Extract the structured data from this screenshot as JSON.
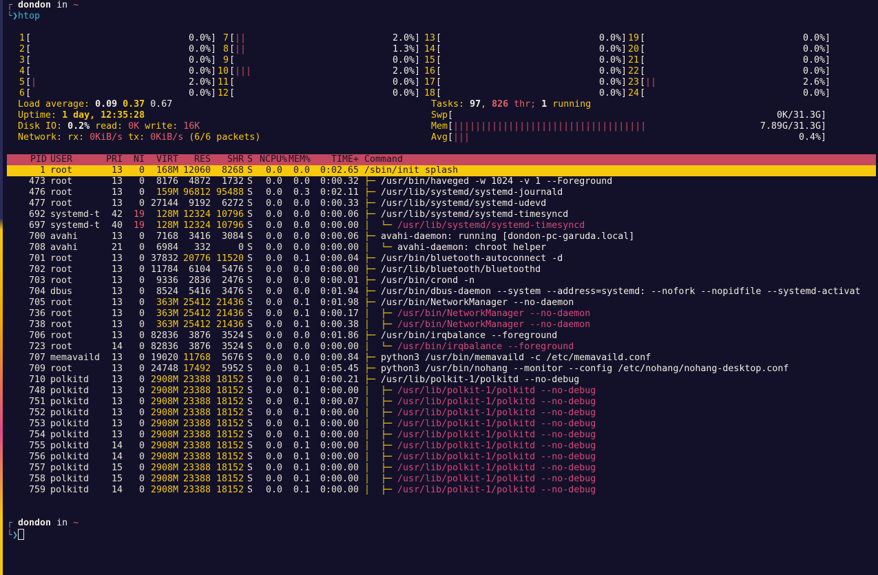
{
  "prompt1": {
    "user": "dondon",
    "in": "in",
    "dir": "~",
    "command": "htop"
  },
  "cpus": [
    {
      "id": "1",
      "bar": "",
      "pct": "0.0%"
    },
    {
      "id": "2",
      "bar": "",
      "pct": "0.0%"
    },
    {
      "id": "3",
      "bar": "",
      "pct": "0.0%"
    },
    {
      "id": "4",
      "bar": "",
      "pct": "0.0%"
    },
    {
      "id": "5",
      "bar": "|",
      "pct": "2.0%"
    },
    {
      "id": "6",
      "bar": "",
      "pct": "0.0%"
    },
    {
      "id": "7",
      "bar": "||",
      "pct": "2.0%"
    },
    {
      "id": "8",
      "bar": "||",
      "pct": "1.3%"
    },
    {
      "id": "9",
      "bar": "",
      "pct": "0.0%"
    },
    {
      "id": "10",
      "bar": "|||",
      "pct": "2.0%"
    },
    {
      "id": "11",
      "bar": "",
      "pct": "0.0%"
    },
    {
      "id": "12",
      "bar": "",
      "pct": "0.0%"
    },
    {
      "id": "13",
      "bar": "",
      "pct": "0.0%"
    },
    {
      "id": "14",
      "bar": "",
      "pct": "0.0%"
    },
    {
      "id": "15",
      "bar": "",
      "pct": "0.0%"
    },
    {
      "id": "16",
      "bar": "",
      "pct": "0.0%"
    },
    {
      "id": "17",
      "bar": "",
      "pct": "0.0%"
    },
    {
      "id": "18",
      "bar": "",
      "pct": "0.0%"
    },
    {
      "id": "19",
      "bar": "",
      "pct": "0.0%"
    },
    {
      "id": "20",
      "bar": "",
      "pct": "0.0%"
    },
    {
      "id": "21",
      "bar": "",
      "pct": "0.0%"
    },
    {
      "id": "22",
      "bar": "",
      "pct": "0.0%"
    },
    {
      "id": "23",
      "bar": "||",
      "pct": "2.6%"
    },
    {
      "id": "24",
      "bar": "",
      "pct": "0.0%"
    }
  ],
  "load": {
    "label": "Load average:",
    "v1": "0.09",
    "v2": "0.37",
    "v3": "0.67"
  },
  "uptime": {
    "label": "Uptime:",
    "value": "1 day, 12:35:28"
  },
  "disk": {
    "label": "Disk IO:",
    "pct": "0.2%",
    "read_label": "read:",
    "read": "0K",
    "write_label": "write:",
    "write": "16K"
  },
  "network": {
    "label": "Network:",
    "rx_label": "rx:",
    "rx": "0KiB/s",
    "tx_label": "tx:",
    "tx": "0KiB/s",
    "packets": "(6/6 packets)"
  },
  "tasks": {
    "label": "Tasks:",
    "count": "97",
    "comma": ",",
    "thr": "826",
    "thr_label": "thr;",
    "running": "1",
    "running_label": "running"
  },
  "swp": {
    "label": "Swp",
    "bar": "",
    "value": "0K/31.3G"
  },
  "mem": {
    "label": "Mem",
    "bar": "|||||||||||||||||||||||||||||||||||",
    "value": "7.89G/31.3G"
  },
  "avg": {
    "label": "Avg",
    "bar": "|||",
    "value": "0.4%"
  },
  "header": {
    "pid": "PID",
    "user": "USER",
    "pri": "PRI",
    "ni": "NI",
    "virt": "VIRT",
    "res": "RES",
    "shr": "SHR",
    "s": "S",
    "cpu": "NCPU%",
    "mem": "MEM%",
    "time": "TIME+",
    "cmd": "Command"
  },
  "processes": [
    {
      "pid": "1",
      "user": "root",
      "pri": "13",
      "ni": "0",
      "virt": "168M",
      "res": "12060",
      "shr": "8268",
      "s": "S",
      "cpu": "0.0",
      "mem": "0.0",
      "time": "0:02.65",
      "tree": "",
      "cmd": "/sbin/init splash",
      "thread": false,
      "selected": true
    },
    {
      "pid": "473",
      "user": "root",
      "pri": "13",
      "ni": "0",
      "virt": "8176",
      "res": "4872",
      "shr": "1732",
      "s": "S",
      "cpu": "0.0",
      "mem": "0.0",
      "time": "0:00.32",
      "tree": "├─ ",
      "cmd": "/usr/bin/haveged -w 1024 -v 1 --Foreground",
      "thread": false
    },
    {
      "pid": "476",
      "user": "root",
      "pri": "13",
      "ni": "0",
      "virt": "159M",
      "res": "96812",
      "shr": "95488",
      "s": "S",
      "cpu": "0.0",
      "mem": "0.3",
      "time": "0:02.11",
      "tree": "├─ ",
      "cmd": "/usr/lib/systemd/systemd-journald",
      "thread": false
    },
    {
      "pid": "477",
      "user": "root",
      "pri": "13",
      "ni": "0",
      "virt": "27144",
      "res": "9192",
      "shr": "6272",
      "s": "S",
      "cpu": "0.0",
      "mem": "0.0",
      "time": "0:00.33",
      "tree": "├─ ",
      "cmd": "/usr/lib/systemd/systemd-udevd",
      "thread": false
    },
    {
      "pid": "692",
      "user": "systemd-t",
      "pri": "42",
      "ni": "19",
      "virt": "128M",
      "res": "12324",
      "shr": "10796",
      "s": "S",
      "cpu": "0.0",
      "mem": "0.0",
      "time": "0:00.06",
      "tree": "├─ ",
      "cmd": "/usr/lib/systemd/systemd-timesyncd",
      "thread": false
    },
    {
      "pid": "697",
      "user": "systemd-t",
      "pri": "40",
      "ni": "19",
      "virt": "128M",
      "res": "12324",
      "shr": "10796",
      "s": "S",
      "cpu": "0.0",
      "mem": "0.0",
      "time": "0:00.00",
      "tree": "│  └─ ",
      "cmd": "/usr/lib/systemd/systemd-timesyncd",
      "thread": true
    },
    {
      "pid": "700",
      "user": "avahi",
      "pri": "13",
      "ni": "0",
      "virt": "7168",
      "res": "3416",
      "shr": "3084",
      "s": "S",
      "cpu": "0.0",
      "mem": "0.0",
      "time": "0:00.06",
      "tree": "├─ ",
      "cmd": "avahi-daemon: running [dondon-pc-garuda.local]",
      "thread": false
    },
    {
      "pid": "708",
      "user": "avahi",
      "pri": "21",
      "ni": "0",
      "virt": "6984",
      "res": "332",
      "shr": "0",
      "s": "S",
      "cpu": "0.0",
      "mem": "0.0",
      "time": "0:00.00",
      "tree": "│  └─ ",
      "cmd": "avahi-daemon: chroot helper",
      "thread": false
    },
    {
      "pid": "701",
      "user": "root",
      "pri": "13",
      "ni": "0",
      "virt": "37832",
      "res": "20776",
      "shr": "11520",
      "s": "S",
      "cpu": "0.0",
      "mem": "0.1",
      "time": "0:00.04",
      "tree": "├─ ",
      "cmd": "/usr/bin/bluetooth-autoconnect -d",
      "thread": false
    },
    {
      "pid": "702",
      "user": "root",
      "pri": "13",
      "ni": "0",
      "virt": "11784",
      "res": "6104",
      "shr": "5476",
      "s": "S",
      "cpu": "0.0",
      "mem": "0.0",
      "time": "0:00.00",
      "tree": "├─ ",
      "cmd": "/usr/lib/bluetooth/bluetoothd",
      "thread": false
    },
    {
      "pid": "703",
      "user": "root",
      "pri": "13",
      "ni": "0",
      "virt": "9336",
      "res": "2836",
      "shr": "2476",
      "s": "S",
      "cpu": "0.0",
      "mem": "0.0",
      "time": "0:00.01",
      "tree": "├─ ",
      "cmd": "/usr/bin/crond -n",
      "thread": false
    },
    {
      "pid": "704",
      "user": "dbus",
      "pri": "13",
      "ni": "0",
      "virt": "8524",
      "res": "5416",
      "shr": "3476",
      "s": "S",
      "cpu": "0.0",
      "mem": "0.0",
      "time": "0:01.94",
      "tree": "├─ ",
      "cmd": "/usr/bin/dbus-daemon --system --address=systemd: --nofork --nopidfile --systemd-activat",
      "thread": false
    },
    {
      "pid": "705",
      "user": "root",
      "pri": "13",
      "ni": "0",
      "virt": "363M",
      "res": "25412",
      "shr": "21436",
      "s": "S",
      "cpu": "0.0",
      "mem": "0.1",
      "time": "0:01.98",
      "tree": "├─ ",
      "cmd": "/usr/bin/NetworkManager --no-daemon",
      "thread": false
    },
    {
      "pid": "736",
      "user": "root",
      "pri": "13",
      "ni": "0",
      "virt": "363M",
      "res": "25412",
      "shr": "21436",
      "s": "S",
      "cpu": "0.0",
      "mem": "0.1",
      "time": "0:00.17",
      "tree": "│  ├─ ",
      "cmd": "/usr/bin/NetworkManager --no-daemon",
      "thread": true
    },
    {
      "pid": "738",
      "user": "root",
      "pri": "13",
      "ni": "0",
      "virt": "363M",
      "res": "25412",
      "shr": "21436",
      "s": "S",
      "cpu": "0.0",
      "mem": "0.1",
      "time": "0:00.38",
      "tree": "│  ├─ ",
      "cmd": "/usr/bin/NetworkManager --no-daemon",
      "thread": true
    },
    {
      "pid": "706",
      "user": "root",
      "pri": "13",
      "ni": "0",
      "virt": "82836",
      "res": "3876",
      "shr": "3524",
      "s": "S",
      "cpu": "0.0",
      "mem": "0.0",
      "time": "0:01.86",
      "tree": "├─ ",
      "cmd": "/usr/bin/irqbalance --foreground",
      "thread": false
    },
    {
      "pid": "723",
      "user": "root",
      "pri": "14",
      "ni": "0",
      "virt": "82836",
      "res": "3876",
      "shr": "3524",
      "s": "S",
      "cpu": "0.0",
      "mem": "0.0",
      "time": "0:00.00",
      "tree": "│  └─ ",
      "cmd": "/usr/bin/irqbalance --foreground",
      "thread": true
    },
    {
      "pid": "707",
      "user": "memavaild",
      "pri": "13",
      "ni": "0",
      "virt": "19020",
      "res": "11768",
      "shr": "5676",
      "s": "S",
      "cpu": "0.0",
      "mem": "0.0",
      "time": "0:00.84",
      "tree": "├─ ",
      "cmd": "python3 /usr/bin/memavaild -c /etc/memavaild.conf",
      "thread": false
    },
    {
      "pid": "709",
      "user": "root",
      "pri": "13",
      "ni": "0",
      "virt": "24748",
      "res": "17492",
      "shr": "5952",
      "s": "S",
      "cpu": "0.0",
      "mem": "0.1",
      "time": "0:05.45",
      "tree": "├─ ",
      "cmd": "python3 /usr/bin/nohang --monitor --config /etc/nohang/nohang-desktop.conf",
      "thread": false
    },
    {
      "pid": "710",
      "user": "polkitd",
      "pri": "13",
      "ni": "0",
      "virt": "2908M",
      "res": "23388",
      "shr": "18152",
      "s": "S",
      "cpu": "0.0",
      "mem": "0.1",
      "time": "0:00.21",
      "tree": "├─ ",
      "cmd": "/usr/lib/polkit-1/polkitd --no-debug",
      "thread": false
    },
    {
      "pid": "748",
      "user": "polkitd",
      "pri": "13",
      "ni": "0",
      "virt": "2908M",
      "res": "23388",
      "shr": "18152",
      "s": "S",
      "cpu": "0.0",
      "mem": "0.1",
      "time": "0:00.00",
      "tree": "│  ├─ ",
      "cmd": "/usr/lib/polkit-1/polkitd --no-debug",
      "thread": true
    },
    {
      "pid": "751",
      "user": "polkitd",
      "pri": "13",
      "ni": "0",
      "virt": "2908M",
      "res": "23388",
      "shr": "18152",
      "s": "S",
      "cpu": "0.0",
      "mem": "0.1",
      "time": "0:00.07",
      "tree": "│  ├─ ",
      "cmd": "/usr/lib/polkit-1/polkitd --no-debug",
      "thread": true
    },
    {
      "pid": "752",
      "user": "polkitd",
      "pri": "13",
      "ni": "0",
      "virt": "2908M",
      "res": "23388",
      "shr": "18152",
      "s": "S",
      "cpu": "0.0",
      "mem": "0.1",
      "time": "0:00.00",
      "tree": "│  ├─ ",
      "cmd": "/usr/lib/polkit-1/polkitd --no-debug",
      "thread": true
    },
    {
      "pid": "753",
      "user": "polkitd",
      "pri": "13",
      "ni": "0",
      "virt": "2908M",
      "res": "23388",
      "shr": "18152",
      "s": "S",
      "cpu": "0.0",
      "mem": "0.1",
      "time": "0:00.00",
      "tree": "│  ├─ ",
      "cmd": "/usr/lib/polkit-1/polkitd --no-debug",
      "thread": true
    },
    {
      "pid": "754",
      "user": "polkitd",
      "pri": "13",
      "ni": "0",
      "virt": "2908M",
      "res": "23388",
      "shr": "18152",
      "s": "S",
      "cpu": "0.0",
      "mem": "0.1",
      "time": "0:00.00",
      "tree": "│  ├─ ",
      "cmd": "/usr/lib/polkit-1/polkitd --no-debug",
      "thread": true
    },
    {
      "pid": "755",
      "user": "polkitd",
      "pri": "14",
      "ni": "0",
      "virt": "2908M",
      "res": "23388",
      "shr": "18152",
      "s": "S",
      "cpu": "0.0",
      "mem": "0.1",
      "time": "0:00.00",
      "tree": "│  ├─ ",
      "cmd": "/usr/lib/polkit-1/polkitd --no-debug",
      "thread": true
    },
    {
      "pid": "756",
      "user": "polkitd",
      "pri": "14",
      "ni": "0",
      "virt": "2908M",
      "res": "23388",
      "shr": "18152",
      "s": "S",
      "cpu": "0.0",
      "mem": "0.1",
      "time": "0:00.00",
      "tree": "│  ├─ ",
      "cmd": "/usr/lib/polkit-1/polkitd --no-debug",
      "thread": true
    },
    {
      "pid": "757",
      "user": "polkitd",
      "pri": "15",
      "ni": "0",
      "virt": "2908M",
      "res": "23388",
      "shr": "18152",
      "s": "S",
      "cpu": "0.0",
      "mem": "0.1",
      "time": "0:00.00",
      "tree": "│  ├─ ",
      "cmd": "/usr/lib/polkit-1/polkitd --no-debug",
      "thread": true
    },
    {
      "pid": "758",
      "user": "polkitd",
      "pri": "15",
      "ni": "0",
      "virt": "2908M",
      "res": "23388",
      "shr": "18152",
      "s": "S",
      "cpu": "0.0",
      "mem": "0.1",
      "time": "0:00.00",
      "tree": "│  ├─ ",
      "cmd": "/usr/lib/polkit-1/polkitd --no-debug",
      "thread": true
    },
    {
      "pid": "759",
      "user": "polkitd",
      "pri": "14",
      "ni": "0",
      "virt": "2908M",
      "res": "23388",
      "shr": "18152",
      "s": "S",
      "cpu": "0.0",
      "mem": "0.1",
      "time": "0:00.00",
      "tree": "│  ├─ ",
      "cmd": "/usr/lib/polkit-1/polkitd --no-debug",
      "thread": true
    }
  ],
  "prompt2": {
    "user": "dondon",
    "in": "in",
    "dir": "~",
    "command": ""
  },
  "colors": {
    "background": "#13112a",
    "accent": "#f6c90e",
    "header": "#c4485f",
    "thread": "#d9477a",
    "prompt": "#33b6d6"
  }
}
